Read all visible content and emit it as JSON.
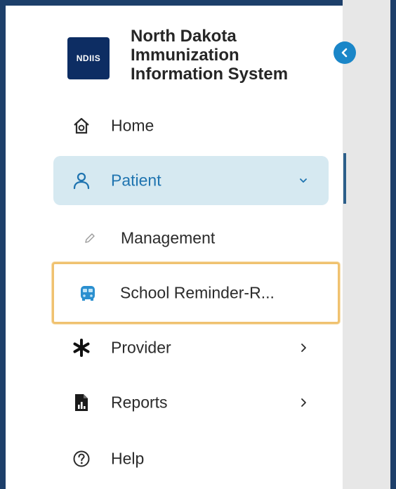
{
  "app": {
    "logo_text": "NDIIS",
    "title_lines": [
      "North Dakota",
      "Immunization",
      "Information System"
    ]
  },
  "nav": {
    "home": {
      "label": "Home",
      "icon": "home-icon"
    },
    "patient": {
      "label": "Patient",
      "icon": "person-icon",
      "state": "expanded"
    },
    "management": {
      "label": "Management",
      "icon": "pencil-icon"
    },
    "school_reminder": {
      "label": "School Reminder-R...",
      "icon": "school-bus-icon",
      "focused": true
    },
    "provider": {
      "label": "Provider",
      "icon": "asterisk-icon"
    },
    "reports": {
      "label": "Reports",
      "icon": "report-document-icon"
    },
    "help": {
      "label": "Help",
      "icon": "help-circle-icon"
    }
  },
  "colors": {
    "frame": "#1d3f6a",
    "accent": "#1a86c8",
    "patient_bg": "#d6e9f1",
    "patient_text": "#1f74b0",
    "focus_border": "#f0c270"
  }
}
